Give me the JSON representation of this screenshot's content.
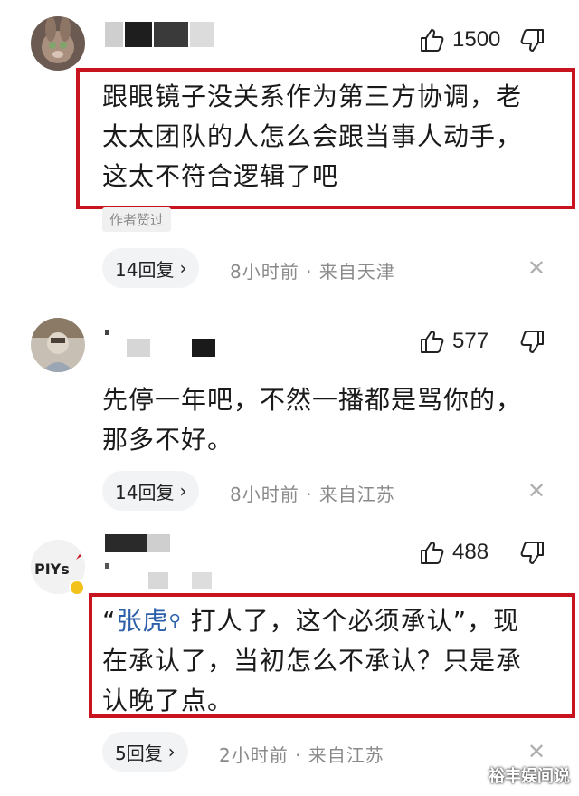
{
  "comments": [
    {
      "likes": "1500",
      "lines": [
        "跟眼镜子没关系作为第三方协调，老",
        "太太团队的人怎么会跟当事人动手，",
        "这太不符合逻辑了吧"
      ],
      "author_badge": "作者赞过",
      "replies": "14回复",
      "meta": "8小时前 · 来自天津"
    },
    {
      "likes": "577",
      "lines": [
        "先停一年吧，不然一播都是骂你的，",
        "那多不好。"
      ],
      "replies": "14回复",
      "meta": "8小时前 · 来自江苏"
    },
    {
      "likes": "488",
      "line1_open": "“",
      "mention": "张虎",
      "line1_rest": " 打人了，这个必须承认”，现",
      "line2": "在承认了，当初怎么不承认？只是承",
      "line3": "认晚了点。",
      "replies": "5回复",
      "meta": "2小时前 · 来自江苏"
    }
  ],
  "icons": {
    "like": "thumbs-up-icon",
    "dislike": "thumbs-down-icon",
    "close": "close-icon",
    "chevron": "chevron-right-icon",
    "search": "search-icon"
  },
  "glyphs": {
    "chevron": "›",
    "close": "✕",
    "search": "⚲"
  },
  "watermark": "裕丰娱间说",
  "colors": {
    "highlight_box": "#c8141e",
    "mention": "#2b5faa",
    "meta": "#8a8a8a"
  }
}
